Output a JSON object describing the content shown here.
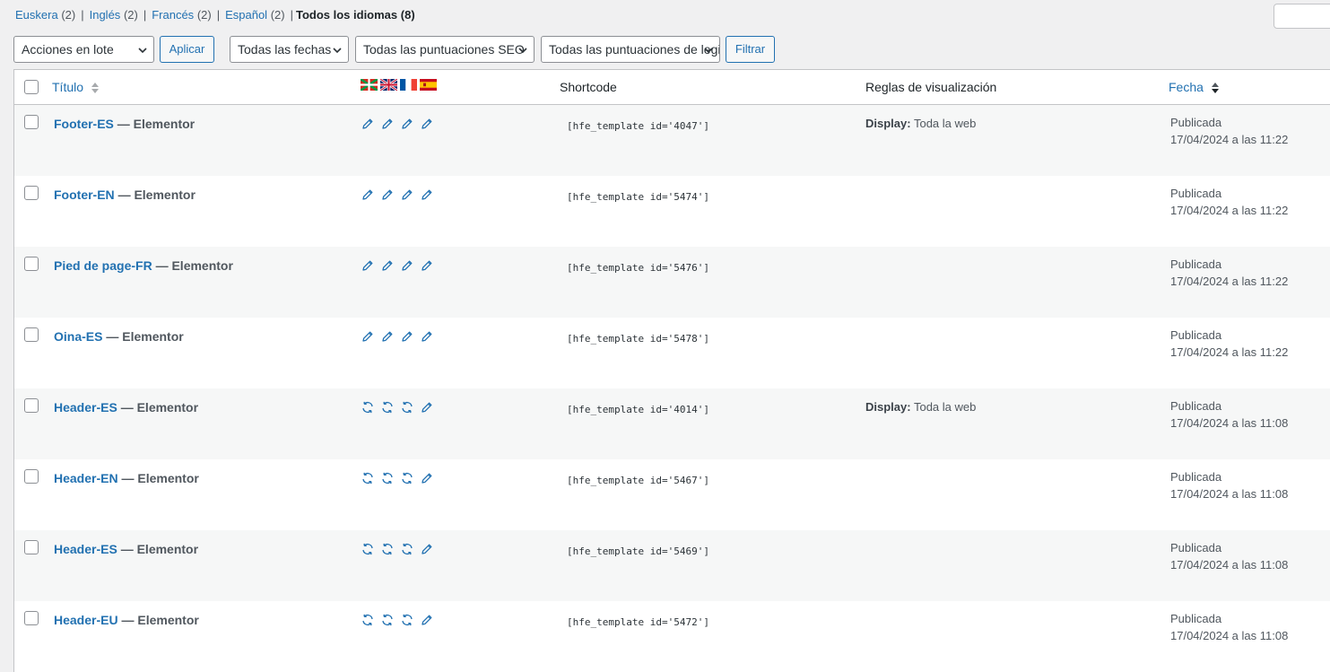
{
  "language_filter": [
    {
      "label": "Euskera",
      "count": "(2)"
    },
    {
      "label": "Inglés",
      "count": "(2)"
    },
    {
      "label": "Francés",
      "count": "(2)"
    },
    {
      "label": "Español",
      "count": "(2)"
    }
  ],
  "language_filter_current": {
    "label": "Todos los idiomas",
    "count": "(8)"
  },
  "toolbar": {
    "bulk_actions": "Acciones en lote",
    "apply": "Aplicar",
    "dates": "Todas las fechas",
    "seo_scores": "Todas las puntuaciones SEO",
    "readability_scores": "Todas las puntuaciones de legibilidad",
    "filter": "Filtrar"
  },
  "columns": {
    "title": "Título",
    "flags": [
      "Euskera",
      "Inglés",
      "Francés",
      "Español"
    ],
    "shortcode": "Shortcode",
    "display_rules": "Reglas de visualización",
    "date": "Fecha"
  },
  "colors": {
    "link": "#2271b1",
    "border": "#c3c4c7",
    "alt_row": "#f6f7f7",
    "bg": "#f0f0f1"
  },
  "rows": [
    {
      "title": "Footer-ES",
      "state": "— Elementor",
      "icons": [
        "pencil-icon",
        "pencil-icon",
        "pencil-icon",
        "pencil-icon"
      ],
      "shortcode": "[hfe_template id='4047']",
      "display_label": "Display:",
      "display_value": "Toda la web",
      "status": "Publicada",
      "date": "17/04/2024 a las 11:22"
    },
    {
      "title": "Footer-EN",
      "state": "— Elementor",
      "icons": [
        "pencil-icon",
        "pencil-icon",
        "pencil-icon",
        "pencil-icon"
      ],
      "shortcode": "[hfe_template id='5474']",
      "display_label": "",
      "display_value": "",
      "status": "Publicada",
      "date": "17/04/2024 a las 11:22"
    },
    {
      "title": "Pied de page-FR",
      "state": "— Elementor",
      "icons": [
        "pencil-icon",
        "pencil-icon",
        "pencil-icon",
        "pencil-icon"
      ],
      "shortcode": "[hfe_template id='5476']",
      "display_label": "",
      "display_value": "",
      "status": "Publicada",
      "date": "17/04/2024 a las 11:22"
    },
    {
      "title": "Oina-ES",
      "state": "— Elementor",
      "icons": [
        "pencil-icon",
        "pencil-icon",
        "pencil-icon",
        "pencil-icon"
      ],
      "shortcode": "[hfe_template id='5478']",
      "display_label": "",
      "display_value": "",
      "status": "Publicada",
      "date": "17/04/2024 a las 11:22"
    },
    {
      "title": "Header-ES",
      "state": "— Elementor",
      "icons": [
        "sync-icon",
        "sync-icon",
        "sync-icon",
        "pencil-icon"
      ],
      "shortcode": "[hfe_template id='4014']",
      "display_label": "Display:",
      "display_value": "Toda la web",
      "status": "Publicada",
      "date": "17/04/2024 a las 11:08"
    },
    {
      "title": "Header-EN",
      "state": "— Elementor",
      "icons": [
        "sync-icon",
        "sync-icon",
        "sync-icon",
        "pencil-icon"
      ],
      "shortcode": "[hfe_template id='5467']",
      "display_label": "",
      "display_value": "",
      "status": "Publicada",
      "date": "17/04/2024 a las 11:08"
    },
    {
      "title": "Header-ES",
      "state": "— Elementor",
      "icons": [
        "sync-icon",
        "sync-icon",
        "sync-icon",
        "pencil-icon"
      ],
      "shortcode": "[hfe_template id='5469']",
      "display_label": "",
      "display_value": "",
      "status": "Publicada",
      "date": "17/04/2024 a las 11:08"
    },
    {
      "title": "Header-EU",
      "state": "— Elementor",
      "icons": [
        "sync-icon",
        "sync-icon",
        "sync-icon",
        "pencil-icon"
      ],
      "shortcode": "[hfe_template id='5472']",
      "display_label": "",
      "display_value": "",
      "status": "Publicada",
      "date": "17/04/2024 a las 11:08"
    }
  ]
}
